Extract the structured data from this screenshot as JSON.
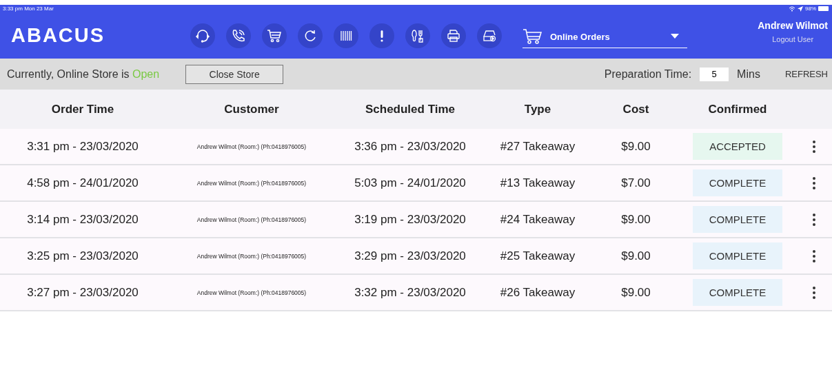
{
  "status_bar": {
    "time": "3:33 pm  Mon 23 Mar",
    "battery": "98%"
  },
  "header": {
    "logo": "ABACUS",
    "order_source": "Online Orders",
    "user": "Andrew Wilmot",
    "logout": "Logout User"
  },
  "toolbar": {
    "store_label": "Currently, Online Store is",
    "store_state": "Open",
    "close_button": "Close Store",
    "prep_label": "Preparation Time:",
    "prep_value": "5",
    "prep_unit": "Mins",
    "refresh": "REFRESH"
  },
  "table": {
    "columns": [
      "Order Time",
      "Customer",
      "Scheduled Time",
      "Type",
      "Cost",
      "Confirmed"
    ],
    "rows": [
      {
        "order_time": "3:31 pm - 23/03/2020",
        "customer": "Andrew Wilmot (Room:) (Ph:0418976005)",
        "scheduled": "3:36 pm - 23/03/2020",
        "type": "#27 Takeaway",
        "cost": "$9.00",
        "status": "ACCEPTED",
        "color": "#e6f7ef"
      },
      {
        "order_time": "4:58 pm - 24/01/2020",
        "customer": "Andrew Wilmot (Room:) (Ph:0418976005)",
        "scheduled": "5:03 pm - 24/01/2020",
        "type": "#13 Takeaway",
        "cost": "$7.00",
        "status": "COMPLETE",
        "color": "#e8f3fb"
      },
      {
        "order_time": "3:14 pm - 23/03/2020",
        "customer": "Andrew Wilmot (Room:) (Ph:0418976005)",
        "scheduled": "3:19 pm - 23/03/2020",
        "type": "#24 Takeaway",
        "cost": "$9.00",
        "status": "COMPLETE",
        "color": "#e8f3fb"
      },
      {
        "order_time": "3:25 pm - 23/03/2020",
        "customer": "Andrew Wilmot (Room:) (Ph:0418976005)",
        "scheduled": "3:29 pm - 23/03/2020",
        "type": "#25 Takeaway",
        "cost": "$9.00",
        "status": "COMPLETE",
        "color": "#e8f3fb"
      },
      {
        "order_time": "3:27 pm - 23/03/2020",
        "customer": "Andrew Wilmot (Room:) (Ph:0418976005)",
        "scheduled": "3:32 pm - 23/03/2020",
        "type": "#26 Takeaway",
        "cost": "$9.00",
        "status": "COMPLETE",
        "color": "#e8f3fb"
      }
    ]
  }
}
